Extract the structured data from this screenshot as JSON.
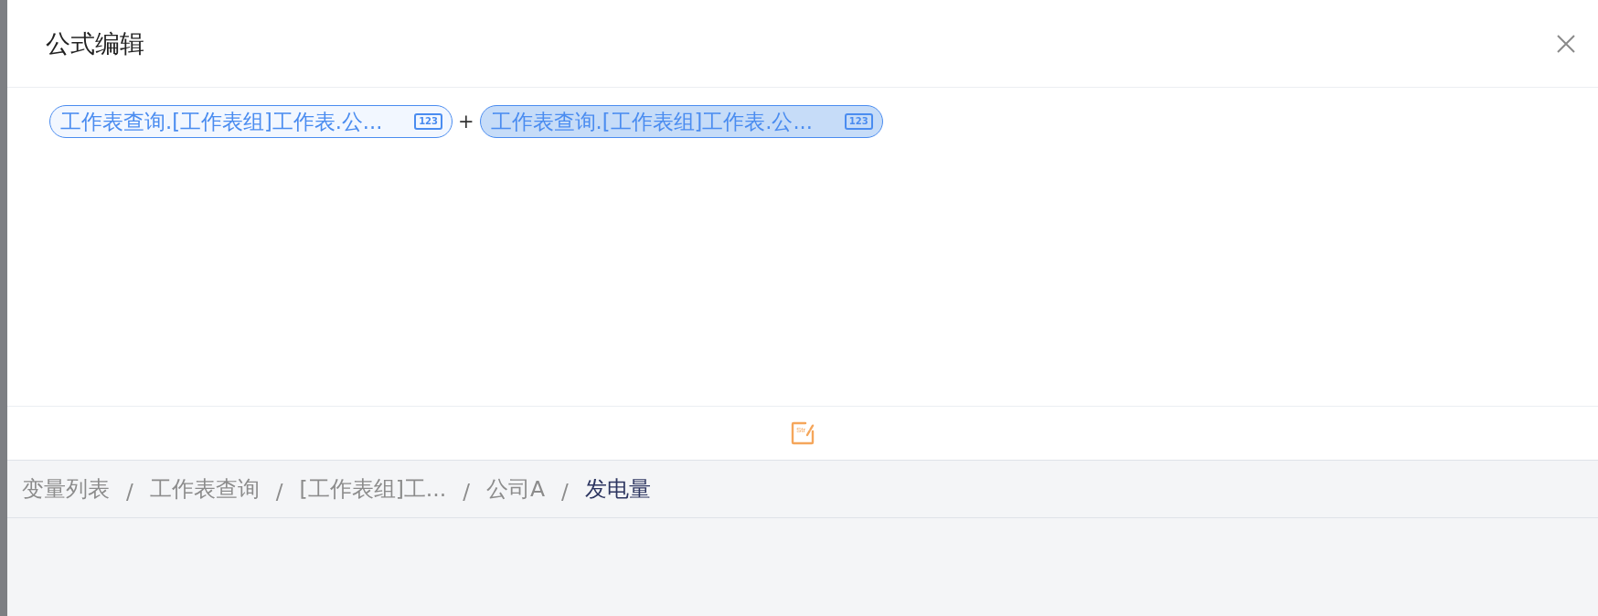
{
  "dialog": {
    "title": "公式编辑"
  },
  "formula": {
    "tokens": [
      {
        "kind": "variable",
        "text": "工作表查询.[工作表组]工作表.公...",
        "badge": "123",
        "selected": false
      },
      {
        "kind": "operator",
        "text": "+"
      },
      {
        "kind": "variable",
        "text": "工作表查询.[工作表组]工作表.公...",
        "badge": "123",
        "selected": true
      }
    ]
  },
  "toolbar": {
    "string_icon_text": "Str"
  },
  "breadcrumb": [
    {
      "text": "变量列表",
      "current": false
    },
    {
      "separator": "/",
      "text": "工作表查询",
      "current": false
    },
    {
      "separator": "/",
      "text": "[工作表组]工...",
      "current": false
    },
    {
      "separator": "/",
      "text": "公司A",
      "current": false
    },
    {
      "separator": "/",
      "text": "发电量",
      "current": true
    }
  ]
}
